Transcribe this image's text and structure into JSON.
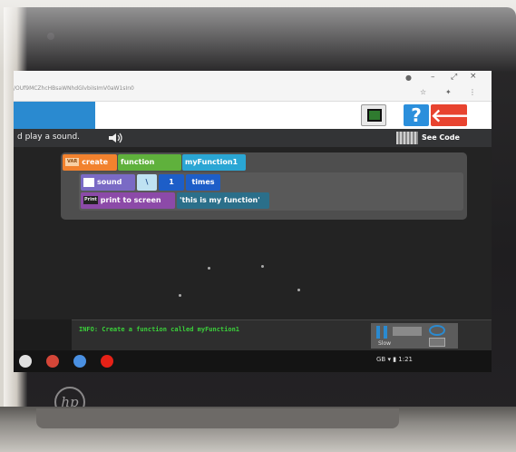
{
  "browser": {
    "url": "/OUf9MCZhcHBsaWNhdGlvbiIsImV0aW1sIn0",
    "minimize": "–",
    "maximize": "⤢",
    "close": "×",
    "star": "☆",
    "extension": "✦",
    "menu": "⋮",
    "profile": "●"
  },
  "toolbar": {
    "help_label": "?",
    "back_label": "🡐"
  },
  "instruction": {
    "text": "d play a sound.",
    "see_code_label": "See Code"
  },
  "blocks": {
    "create_tag": "VAR",
    "create_label": "create",
    "function_label": "function",
    "function_name": "myFunction1",
    "sound_label": "sound",
    "sound_value": "\\",
    "repeat_count": "1",
    "times_label": "times",
    "print_tag": "Print",
    "print_label": "print to screen",
    "print_value": "'this is my function'"
  },
  "info": {
    "text": "INFO: Create a function called myFunction1",
    "speed_label": "Slow"
  },
  "shelf": {
    "status": "GB  ▾  ▮ 1:21"
  },
  "device": {
    "logo": "hp"
  },
  "colors": {
    "create_block": "#f2822e",
    "function_block": "#5fb13c",
    "name_block": "#2aa6d4",
    "sound_block": "#7a6ac5",
    "number_block": "#1d5ec8",
    "print_block": "#8c4aa8",
    "info_text": "#3bd13b",
    "help_button": "#2b8fdc",
    "back_button": "#e8432f"
  }
}
